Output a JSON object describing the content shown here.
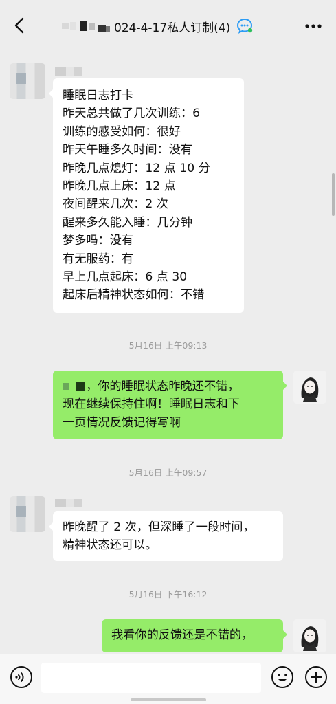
{
  "header": {
    "title": "024-4-17私人订制(4)",
    "back_icon": "chevron-left-icon",
    "more_icon": "more-dots-icon",
    "group_icon": "group-chat-icon"
  },
  "messages": [
    {
      "sender": "other",
      "lines": [
        "睡眠日志打卡",
        "昨天总共做了几次训练：6",
        "训练的感受如何：很好",
        "昨天午睡多久时间：没有",
        "昨晚几点熄灯：12 点 10 分",
        "昨晚几点上床：12 点",
        "夜间醒来几次：2 次",
        "醒来多久能入睡：几分钟",
        "梦多吗：没有",
        "有无服药：有",
        "早上几点起床：6 点 30",
        "起床后精神状态如何：不错"
      ]
    },
    {
      "sender": "me",
      "timestamp": "5月16日 上午09:13",
      "lines": [
        "，你的睡眠状态昨晚还不错，",
        "现在继续保持住啊！睡眠日志和下",
        "一页情况反馈记得写啊"
      ]
    },
    {
      "sender": "other",
      "timestamp": "5月16日 上午09:57",
      "lines": [
        "昨晚醒了 2 次，但深睡了一段时间，",
        "精神状态还可以。"
      ]
    },
    {
      "sender": "me",
      "timestamp": "5月16日 下午16:12",
      "lines": [
        "我看你的反馈还是不错的，"
      ]
    }
  ],
  "input_bar": {
    "voice_icon": "voice-icon",
    "emoji_icon": "emoji-icon",
    "add_icon": "plus-icon"
  },
  "colors": {
    "background": "#ededed",
    "my_bubble": "#95ec69",
    "other_bubble": "#ffffff",
    "group_icon_accent": "#2c9cf5"
  }
}
